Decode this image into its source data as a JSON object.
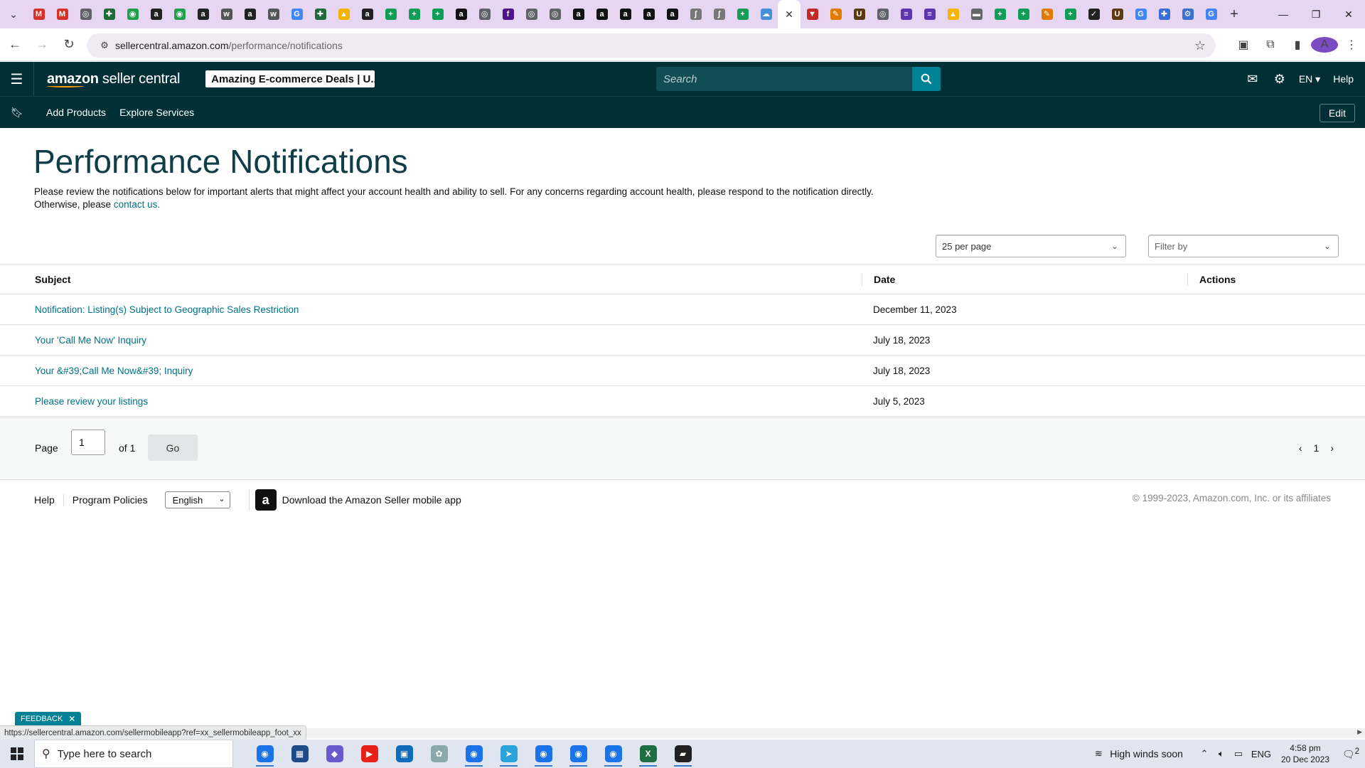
{
  "browser": {
    "url_host": "sellercentral.amazon.com",
    "url_path": "/performance/notifications",
    "profile_initial": "A",
    "tab_favicons": [
      {
        "name": "gmail",
        "glyph": "M",
        "color": "#d93025"
      },
      {
        "name": "gmail",
        "glyph": "M",
        "color": "#d93025"
      },
      {
        "name": "globe",
        "glyph": "◎",
        "color": "#5f6368"
      },
      {
        "name": "extension",
        "glyph": "✚",
        "color": "#1e6b3a"
      },
      {
        "name": "shop",
        "glyph": "◉",
        "color": "#21a04b"
      },
      {
        "name": "amazon",
        "glyph": "a",
        "color": "#222"
      },
      {
        "name": "shop",
        "glyph": "◉",
        "color": "#21a04b"
      },
      {
        "name": "amazon",
        "glyph": "a",
        "color": "#222"
      },
      {
        "name": "wix",
        "glyph": "w",
        "color": "#555"
      },
      {
        "name": "amazon",
        "glyph": "a",
        "color": "#222"
      },
      {
        "name": "wix",
        "glyph": "w",
        "color": "#555"
      },
      {
        "name": "google",
        "glyph": "G",
        "color": "#4285f4"
      },
      {
        "name": "extension",
        "glyph": "✚",
        "color": "#1e6b3a"
      },
      {
        "name": "drive",
        "glyph": "▲",
        "color": "#f4b400"
      },
      {
        "name": "amazon",
        "glyph": "a",
        "color": "#222"
      },
      {
        "name": "sheets",
        "glyph": "+",
        "color": "#0f9d58"
      },
      {
        "name": "sheets",
        "glyph": "+",
        "color": "#0f9d58"
      },
      {
        "name": "sheets",
        "glyph": "+",
        "color": "#0f9d58"
      },
      {
        "name": "amazon",
        "glyph": "a",
        "color": "#111"
      },
      {
        "name": "globe",
        "glyph": "◎",
        "color": "#5f6368"
      },
      {
        "name": "fedex",
        "glyph": "f",
        "color": "#4d148c"
      },
      {
        "name": "globe",
        "glyph": "◎",
        "color": "#5f6368"
      },
      {
        "name": "globe",
        "glyph": "◎",
        "color": "#5f6368"
      },
      {
        "name": "amazon",
        "glyph": "a",
        "color": "#111"
      },
      {
        "name": "amazon",
        "glyph": "a",
        "color": "#111"
      },
      {
        "name": "amazon",
        "glyph": "a",
        "color": "#111"
      },
      {
        "name": "amazon",
        "glyph": "a",
        "color": "#111"
      },
      {
        "name": "amazon",
        "glyph": "a",
        "color": "#111"
      },
      {
        "name": "tool",
        "glyph": "ʃ",
        "color": "#777"
      },
      {
        "name": "tool",
        "glyph": "ʃ",
        "color": "#777"
      },
      {
        "name": "sheets",
        "glyph": "+",
        "color": "#0f9d58"
      },
      {
        "name": "cloud",
        "glyph": "☁",
        "color": "#4a90d9"
      }
    ],
    "tab_favicons_after": [
      {
        "name": "flag",
        "glyph": "▼",
        "color": "#c62828"
      },
      {
        "name": "pen",
        "glyph": "✎",
        "color": "#e07b00"
      },
      {
        "name": "ups",
        "glyph": "U",
        "color": "#5b3a12"
      },
      {
        "name": "globe",
        "glyph": "◎",
        "color": "#5f6368"
      },
      {
        "name": "forms",
        "glyph": "≡",
        "color": "#5e35b1"
      },
      {
        "name": "forms",
        "glyph": "≡",
        "color": "#5e35b1"
      },
      {
        "name": "drive",
        "glyph": "▲",
        "color": "#f4b400"
      },
      {
        "name": "badge",
        "glyph": "▬",
        "color": "#666"
      },
      {
        "name": "sheets",
        "glyph": "+",
        "color": "#0f9d58"
      },
      {
        "name": "sheets",
        "glyph": "+",
        "color": "#0f9d58"
      },
      {
        "name": "pen",
        "glyph": "✎",
        "color": "#e07b00"
      },
      {
        "name": "sheets",
        "glyph": "+",
        "color": "#0f9d58"
      },
      {
        "name": "check",
        "glyph": "✓",
        "color": "#222"
      },
      {
        "name": "ups",
        "glyph": "U",
        "color": "#5b3a12"
      },
      {
        "name": "google",
        "glyph": "G",
        "color": "#4285f4"
      },
      {
        "name": "extension",
        "glyph": "✚",
        "color": "#3b6fd8"
      },
      {
        "name": "settings",
        "glyph": "⚙",
        "color": "#3b6fd8"
      },
      {
        "name": "google",
        "glyph": "G",
        "color": "#4285f4"
      }
    ]
  },
  "header": {
    "logo_text": "amazon seller central",
    "logo_amazon": "amazon",
    "logo_rest": " seller central",
    "store_name": "Amazing E-commerce Deals | U...",
    "search_placeholder": "Search",
    "language": "EN",
    "help": "Help"
  },
  "subnav": {
    "add_products": "Add Products",
    "explore_services": "Explore Services",
    "edit": "Edit"
  },
  "main": {
    "title": "Performance Notifications",
    "description": "Please review the notifications below for important alerts that might affect your account health and ability to sell. For any concerns regarding account health, please respond to the notification directly. Otherwise, please",
    "contact_link": "contact us.",
    "per_page": "25 per page",
    "filter_by": "Filter by",
    "columns": [
      "Subject",
      "Date",
      "Actions"
    ],
    "rows": [
      {
        "subject": "Notification: Listing(s) Subject to Geographic Sales Restriction",
        "date": "December 11, 2023",
        "actions": ""
      },
      {
        "subject": "Your 'Call Me Now' Inquiry",
        "date": "July 18, 2023",
        "actions": ""
      },
      {
        "subject": "Your &#39;Call Me Now&#39; Inquiry",
        "date": "July 18, 2023",
        "actions": ""
      },
      {
        "subject": "Please review your listings",
        "date": "July 5, 2023",
        "actions": ""
      }
    ],
    "pager": {
      "page_label": "Page",
      "page_value": "1",
      "of_label": "of 1",
      "go": "Go",
      "current_page": "1"
    }
  },
  "footer": {
    "help": "Help",
    "program_policies": "Program Policies",
    "language": "English",
    "app_link": "Download the Amazon Seller mobile app",
    "copyright": "© 1999-2023, Amazon.com, Inc. or its affiliates"
  },
  "feedback": "FEEDBACK",
  "status_url": "https://sellercentral.amazon.com/sellermobileapp?ref=xx_sellermobileapp_foot_xx",
  "taskbar": {
    "search_placeholder": "Type here to search",
    "apps": [
      {
        "name": "chrome",
        "glyph": "◉",
        "color": "#1a73e8",
        "open": true
      },
      {
        "name": "calculator",
        "glyph": "▦",
        "color": "#1e4a8a",
        "open": false
      },
      {
        "name": "copilot",
        "glyph": "◆",
        "color": "#6a5acd",
        "open": false
      },
      {
        "name": "youtube",
        "glyph": "▶",
        "color": "#e62117",
        "open": false
      },
      {
        "name": "store",
        "glyph": "▣",
        "color": "#0f6cbd",
        "open": false
      },
      {
        "name": "paint",
        "glyph": "✿",
        "color": "#8aa",
        "open": false
      },
      {
        "name": "chrome",
        "glyph": "◉",
        "color": "#1a73e8",
        "open": true
      },
      {
        "name": "telegram",
        "glyph": "➤",
        "color": "#2aa1da",
        "open": true
      },
      {
        "name": "chrome",
        "glyph": "◉",
        "color": "#1a73e8",
        "open": true
      },
      {
        "name": "chrome",
        "glyph": "◉",
        "color": "#1a73e8",
        "open": true
      },
      {
        "name": "chrome",
        "glyph": "◉",
        "color": "#1a73e8",
        "open": true
      },
      {
        "name": "excel",
        "glyph": "X",
        "color": "#1d6f42",
        "open": true
      },
      {
        "name": "sticky-notes",
        "glyph": "▰",
        "color": "#222",
        "open": true
      }
    ],
    "weather": "High winds soon",
    "language": "ENG",
    "time": "4:58 pm",
    "date": "20 Dec 2023",
    "notifications": "2"
  },
  "colors": {
    "header_bg": "#002f36",
    "link": "#007185",
    "search_btn": "#008296"
  }
}
